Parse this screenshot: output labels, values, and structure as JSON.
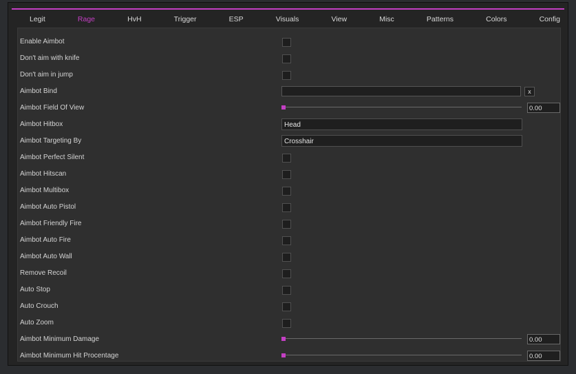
{
  "theme": {
    "accent": "#c43fc4"
  },
  "tabs": [
    {
      "id": "legit",
      "label": "Legit",
      "active": false
    },
    {
      "id": "rage",
      "label": "Rage",
      "active": true
    },
    {
      "id": "hvh",
      "label": "HvH",
      "active": false
    },
    {
      "id": "trigger",
      "label": "Trigger",
      "active": false
    },
    {
      "id": "esp",
      "label": "ESP",
      "active": false
    },
    {
      "id": "visuals",
      "label": "Visuals",
      "active": false
    },
    {
      "id": "view",
      "label": "View",
      "active": false
    },
    {
      "id": "misc",
      "label": "Misc",
      "active": false
    },
    {
      "id": "patterns",
      "label": "Patterns",
      "active": false
    },
    {
      "id": "colors",
      "label": "Colors",
      "active": false
    },
    {
      "id": "config",
      "label": "Config",
      "active": false
    }
  ],
  "rage": {
    "rows": [
      {
        "id": "enable-aimbot",
        "label": "Enable Aimbot",
        "type": "checkbox",
        "checked": false
      },
      {
        "id": "dont-aim-knife",
        "label": "Don't aim with knife",
        "type": "checkbox",
        "checked": false
      },
      {
        "id": "dont-aim-jump",
        "label": "Don't aim in jump",
        "type": "checkbox",
        "checked": false
      },
      {
        "id": "aimbot-bind",
        "label": "Aimbot Bind",
        "type": "bind",
        "value": "",
        "clear_label": "x"
      },
      {
        "id": "aimbot-fov",
        "label": "Aimbot Field Of View",
        "type": "slider",
        "value": 0.0,
        "display": "0.00"
      },
      {
        "id": "aimbot-hitbox",
        "label": "Aimbot Hitbox",
        "type": "select",
        "value": "Head"
      },
      {
        "id": "aimbot-targeting",
        "label": "Aimbot Targeting By",
        "type": "select",
        "value": "Crosshair"
      },
      {
        "id": "perfect-silent",
        "label": "Aimbot Perfect Silent",
        "type": "checkbox",
        "checked": false
      },
      {
        "id": "hitscan",
        "label": "Aimbot Hitscan",
        "type": "checkbox",
        "checked": false
      },
      {
        "id": "multibox",
        "label": "Aimbot Multibox",
        "type": "checkbox",
        "checked": false
      },
      {
        "id": "auto-pistol",
        "label": "Aimbot Auto Pistol",
        "type": "checkbox",
        "checked": false
      },
      {
        "id": "friendly-fire",
        "label": "Aimbot Friendly Fire",
        "type": "checkbox",
        "checked": false
      },
      {
        "id": "auto-fire",
        "label": "Aimbot Auto Fire",
        "type": "checkbox",
        "checked": false
      },
      {
        "id": "auto-wall",
        "label": "Aimbot Auto Wall",
        "type": "checkbox",
        "checked": false
      },
      {
        "id": "remove-recoil",
        "label": "Remove Recoil",
        "type": "checkbox",
        "checked": false
      },
      {
        "id": "auto-stop",
        "label": "Auto Stop",
        "type": "checkbox",
        "checked": false
      },
      {
        "id": "auto-crouch",
        "label": "Auto Crouch",
        "type": "checkbox",
        "checked": false
      },
      {
        "id": "auto-zoom",
        "label": "Auto Zoom",
        "type": "checkbox",
        "checked": false
      },
      {
        "id": "min-damage",
        "label": "Aimbot Minimum Damage",
        "type": "slider",
        "value": 0.0,
        "display": "0.00"
      },
      {
        "id": "min-hit-percentage",
        "label": "Aimbot Minimum Hit  Procentage",
        "type": "slider",
        "value": 0.0,
        "display": "0.00"
      }
    ]
  }
}
